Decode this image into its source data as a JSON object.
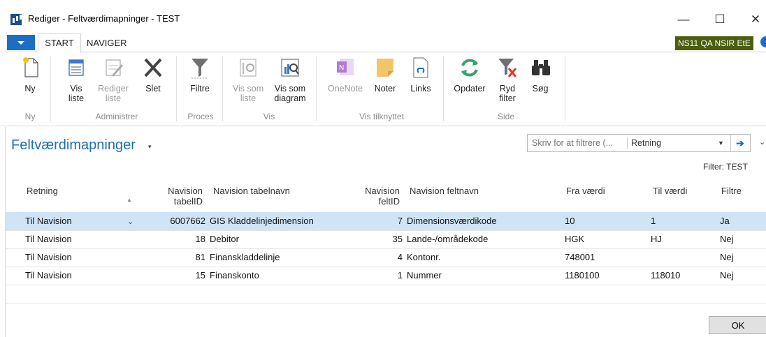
{
  "window": {
    "title": "Rediger - Feltværdimapninger - TEST",
    "minimize": "—",
    "maximize": "☐",
    "close": "✕"
  },
  "ribbon_tabs": {
    "start": "START",
    "naviger": "NAVIGER"
  },
  "company": "NS11 QA NSIR EtE",
  "ribbon": {
    "ny": "Ny",
    "vis_liste_1": "Vis",
    "vis_liste_2": "liste",
    "rediger_liste_1": "Rediger",
    "rediger_liste_2": "liste",
    "slet": "Slet",
    "filtre": "Filtre",
    "vis_som_liste_1": "Vis som",
    "vis_som_liste_2": "liste",
    "vis_som_diagram_1": "Vis som",
    "vis_som_diagram_2": "diagram",
    "onenote": "OneNote",
    "noter": "Noter",
    "links": "Links",
    "opdater": "Opdater",
    "ryd_filter_1": "Ryd",
    "ryd_filter_2": "filter",
    "sog": "Søg",
    "groups": {
      "ny": "Ny",
      "administrer": "Administrer",
      "proces": "Proces",
      "vis": "Vis",
      "vis_tilknyttet": "Vis tilknyttet",
      "side": "Side"
    }
  },
  "page": {
    "title": "Feltværdimapninger",
    "title_caret": "▾",
    "filter_placeholder": "Skriv for at filtrere (...",
    "filter_field": "Retning",
    "filter_dd": "▼",
    "filter_go": "➔",
    "collapse": "⌄",
    "filter_label": "Filter: TEST"
  },
  "table": {
    "headers": {
      "retning": "Retning",
      "sort": "▲",
      "tabelid_1": "Navision",
      "tabelid_2": "tabelID",
      "tabelnavn": "Navision tabelnavn",
      "feltid_1": "Navision",
      "feltid_2": "feltID",
      "feltnavn": "Navision feltnavn",
      "fra": "Fra værdi",
      "til": "Til værdi",
      "filtre": "Filtre"
    },
    "rows": [
      {
        "retning": "Til Navision",
        "tabelid": "6007662",
        "tabelnavn": "GIS Kladdelinjedimension",
        "feltid": "7",
        "feltnavn": "Dimensionsværdikode",
        "fra": "10",
        "til": "1",
        "filtre": "Ja"
      },
      {
        "retning": "Til Navision",
        "tabelid": "18",
        "tabelnavn": "Debitor",
        "feltid": "35",
        "feltnavn": "Lande-/områdekode",
        "fra": "HGK",
        "til": "HJ",
        "filtre": "Nej"
      },
      {
        "retning": "Til Navision",
        "tabelid": "81",
        "tabelnavn": "Finanskladdelinje",
        "feltid": "4",
        "feltnavn": "Kontonr.",
        "fra": "748001",
        "til": "",
        "filtre": "Nej"
      },
      {
        "retning": "Til Navision",
        "tabelid": "15",
        "tabelnavn": "Finanskonto",
        "feltid": "1",
        "feltnavn": "Nummer",
        "fra": "1180100",
        "til": "118010",
        "filtre": "Nej"
      }
    ],
    "row_dropdown": "⌄"
  },
  "ok": "OK",
  "colors": {
    "accent": "#1b6ec2",
    "selected_row": "#cfe4f5",
    "company_bg": "#4c5d10",
    "title": "#1f6fb2"
  }
}
